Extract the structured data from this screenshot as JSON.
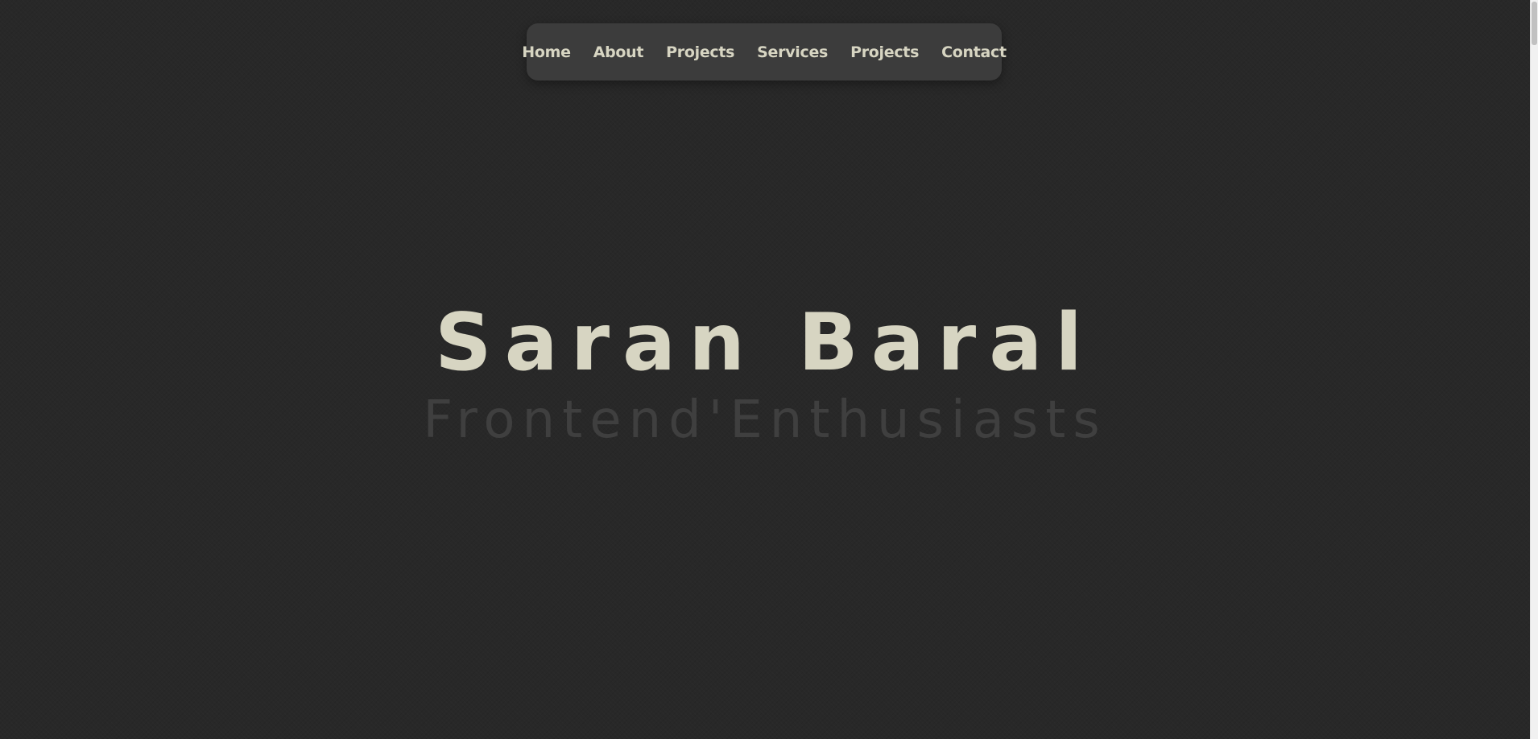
{
  "nav": {
    "items": [
      {
        "label": "Home"
      },
      {
        "label": "About"
      },
      {
        "label": "Projects"
      },
      {
        "label": "Services"
      },
      {
        "label": "Projects"
      },
      {
        "label": "Contact"
      }
    ]
  },
  "hero": {
    "name": "Saran Baral",
    "subtitle": "Frontend'Enthusiasts"
  },
  "colors": {
    "background": "#282828",
    "navbar_bg": "#3c3c3c",
    "primary_text": "#d7d5c2",
    "subtitle_text": "#3f3f3f"
  }
}
